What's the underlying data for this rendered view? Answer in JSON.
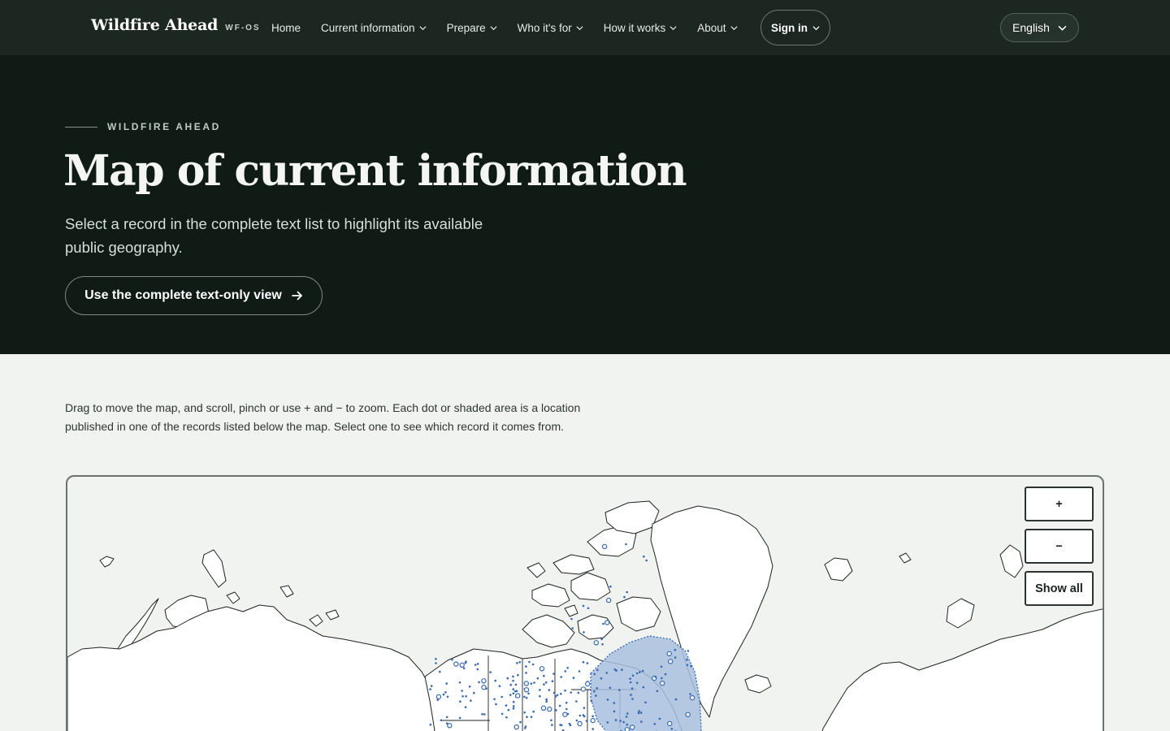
{
  "header": {
    "brand": "Wildfire Ahead",
    "brand_tag": "WF-OS",
    "nav": [
      "Home",
      "Current information",
      "Prepare",
      "Who it's for",
      "How it works",
      "About"
    ],
    "sign_in": "Sign in",
    "language": "English"
  },
  "hero": {
    "eyebrow": "WILDFIRE AHEAD",
    "title": "Map of current information",
    "subtitle": "Select a record in the complete text list to highlight its available public geography.",
    "cta": "Use the complete text-only view"
  },
  "map": {
    "instructions": "Drag to move the map, and scroll, pinch or use + and − to zoom. Each dot or shaded area is a location published in one of the records listed below the map. Select one to see which record it comes from.",
    "zoom_in": "+",
    "zoom_out": "−",
    "show_all": "Show all"
  },
  "colors": {
    "nav_bg": "#1c2722",
    "hero_bg": "#101b16",
    "page_bg": "#f1f3f1",
    "marker": "#3568b0",
    "area_fill": "#a9bfdf"
  }
}
